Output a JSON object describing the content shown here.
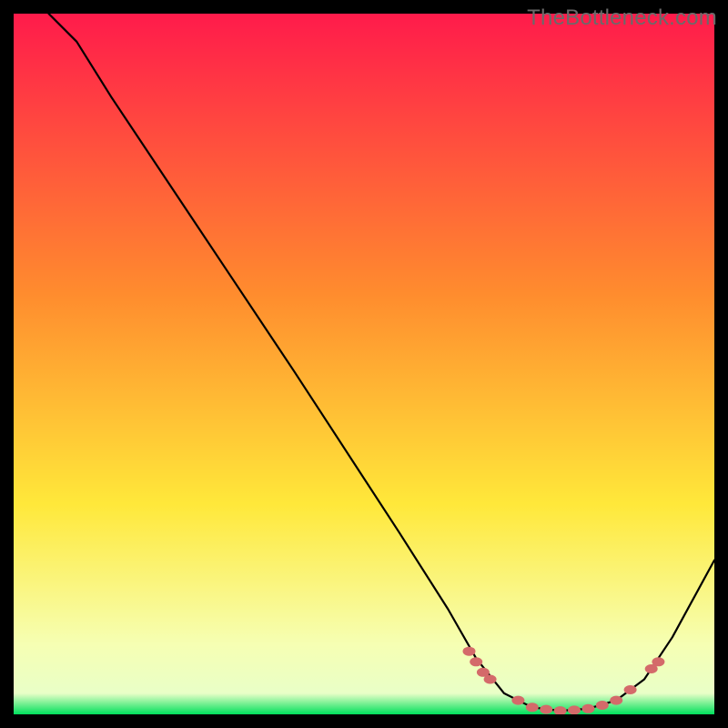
{
  "watermark": "TheBottleneck.com",
  "chart_data": {
    "type": "line",
    "title": "",
    "xlabel": "",
    "ylabel": "",
    "xlim": [
      0,
      100
    ],
    "ylim": [
      0,
      100
    ],
    "background_gradient": {
      "stops": [
        {
          "offset": 0.0,
          "color": "#ff1b4b"
        },
        {
          "offset": 0.4,
          "color": "#ff8c2e"
        },
        {
          "offset": 0.7,
          "color": "#ffe83a"
        },
        {
          "offset": 0.9,
          "color": "#f6ffb3"
        },
        {
          "offset": 0.97,
          "color": "#e9ffc7"
        },
        {
          "offset": 1.0,
          "color": "#00e05c"
        }
      ]
    },
    "series": [
      {
        "name": "bottleneck-curve",
        "stroke": "#000000",
        "stroke_width": 2.2,
        "points": [
          {
            "x": 5,
            "y": 100
          },
          {
            "x": 9,
            "y": 96
          },
          {
            "x": 14,
            "y": 88
          },
          {
            "x": 26,
            "y": 70
          },
          {
            "x": 40,
            "y": 49
          },
          {
            "x": 55,
            "y": 26
          },
          {
            "x": 62,
            "y": 15
          },
          {
            "x": 66,
            "y": 8
          },
          {
            "x": 70,
            "y": 3
          },
          {
            "x": 74,
            "y": 1
          },
          {
            "x": 78,
            "y": 0.5
          },
          {
            "x": 82,
            "y": 0.8
          },
          {
            "x": 86,
            "y": 2
          },
          {
            "x": 90,
            "y": 5
          },
          {
            "x": 94,
            "y": 11
          },
          {
            "x": 100,
            "y": 22
          }
        ]
      }
    ],
    "markers": {
      "color": "#d46a6a",
      "points": [
        {
          "x": 65,
          "y": 9
        },
        {
          "x": 66,
          "y": 7.5
        },
        {
          "x": 67,
          "y": 6
        },
        {
          "x": 68,
          "y": 5
        },
        {
          "x": 72,
          "y": 2
        },
        {
          "x": 74,
          "y": 1
        },
        {
          "x": 76,
          "y": 0.7
        },
        {
          "x": 78,
          "y": 0.5
        },
        {
          "x": 80,
          "y": 0.6
        },
        {
          "x": 82,
          "y": 0.8
        },
        {
          "x": 84,
          "y": 1.3
        },
        {
          "x": 86,
          "y": 2
        },
        {
          "x": 88,
          "y": 3.5
        },
        {
          "x": 91,
          "y": 6.5
        },
        {
          "x": 92,
          "y": 7.5
        }
      ]
    }
  }
}
